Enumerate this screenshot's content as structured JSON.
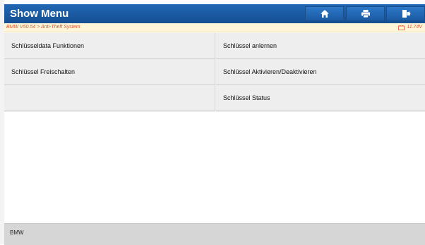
{
  "header": {
    "title": "Show Menu",
    "buttons": [
      {
        "name": "home-button",
        "icon": "home-icon"
      },
      {
        "name": "print-button",
        "icon": "printer-icon"
      },
      {
        "name": "exit-button",
        "icon": "exit-icon"
      }
    ]
  },
  "breadcrumb": {
    "path": "BMW V50.54 > Anti-Theft System",
    "voltage": "11.74V",
    "voltage_icon": "battery-icon"
  },
  "menu": {
    "items": [
      {
        "label": "Schlüsseldata Funktionen"
      },
      {
        "label": "Schlüssel anlernen"
      },
      {
        "label": "Schlüssel Freischalten"
      },
      {
        "label": "Schlüssel Aktivieren/Deaktivieren"
      },
      {
        "label": ""
      },
      {
        "label": "Schlüssel Status"
      }
    ]
  },
  "footer": {
    "label": "BMW"
  },
  "colors": {
    "titlebar": "#1b5aa2",
    "breadcrumb_text": "#e0532a",
    "breadcrumb_bg": "#fff6d9",
    "menu_bg": "#eeeeee"
  }
}
